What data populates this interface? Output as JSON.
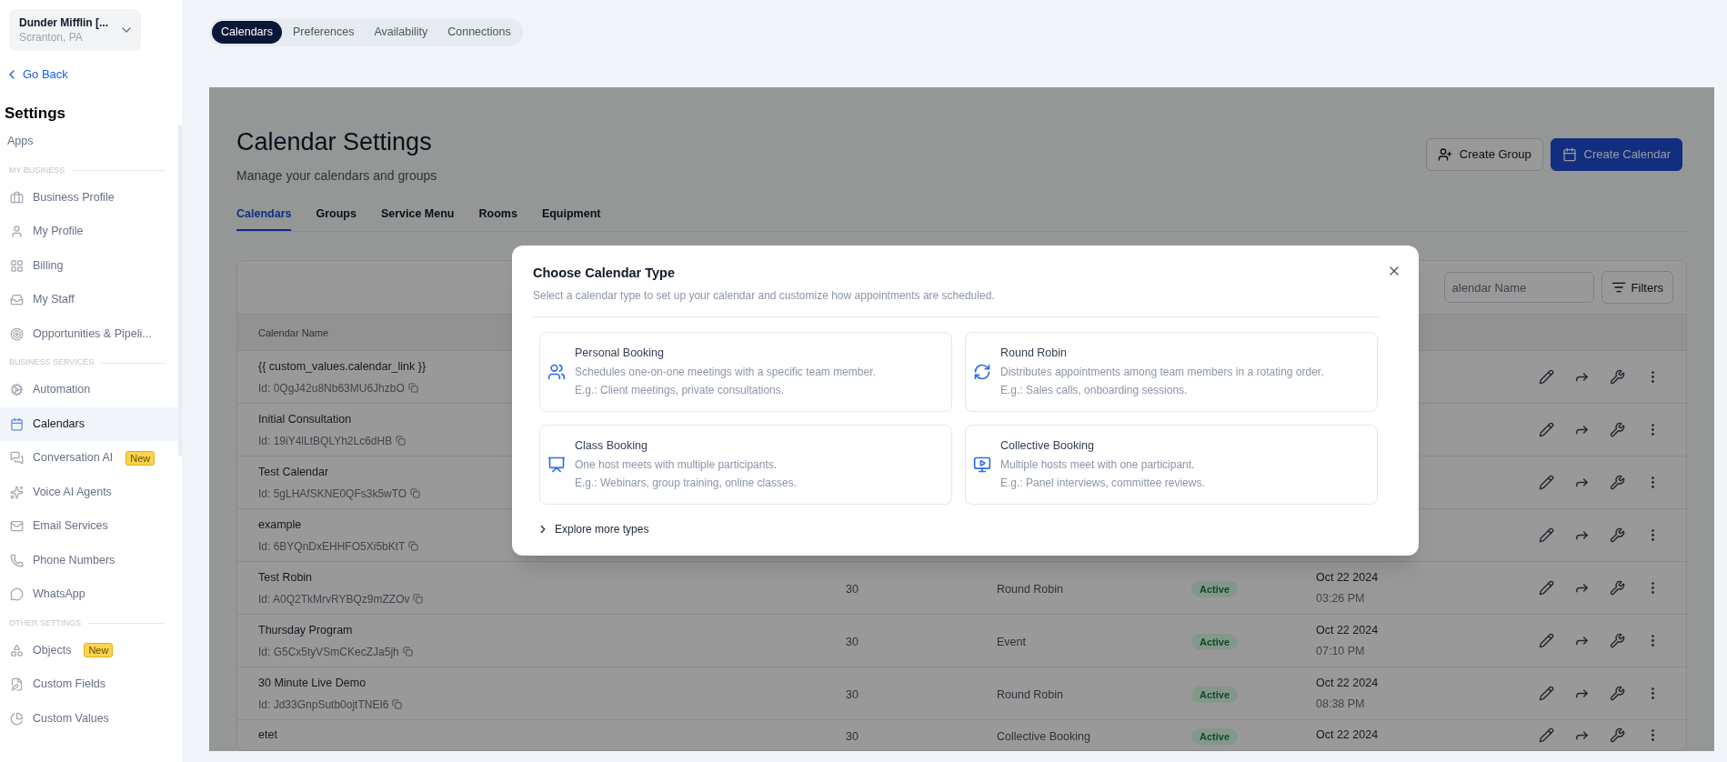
{
  "account": {
    "name": "Dunder Mifflin [...",
    "location": "Scranton, PA"
  },
  "back_link": "Go Back",
  "sidebar": {
    "title": "Settings",
    "sections": [
      {
        "items": [
          {
            "label": "Apps",
            "selected": false
          }
        ]
      },
      {
        "heading": "MY BUSINESS",
        "items": [
          {
            "label": "Business Profile",
            "selected": false
          },
          {
            "label": "My Profile",
            "selected": false
          },
          {
            "label": "Billing",
            "selected": false
          },
          {
            "label": "My Staff",
            "selected": false
          },
          {
            "label": "Opportunities & Pipeli...",
            "selected": false
          }
        ]
      },
      {
        "heading": "BUSINESS SERVICES",
        "items": [
          {
            "label": "Automation",
            "selected": false
          },
          {
            "label": "Calendars",
            "selected": true
          },
          {
            "label": "Conversation AI",
            "selected": false,
            "badge": "New"
          },
          {
            "label": "Voice AI Agents",
            "selected": false
          },
          {
            "label": "Email Services",
            "selected": false
          },
          {
            "label": "Phone Numbers",
            "selected": false
          },
          {
            "label": "WhatsApp",
            "selected": false
          }
        ]
      },
      {
        "heading": "OTHER SETTINGS",
        "items": [
          {
            "label": "Objects",
            "selected": false,
            "badge": "New"
          },
          {
            "label": "Custom Fields",
            "selected": false
          },
          {
            "label": "Custom Values",
            "selected": false
          }
        ]
      }
    ]
  },
  "top_tabs": [
    {
      "label": "Calendars",
      "selected": true
    },
    {
      "label": "Preferences",
      "selected": false
    },
    {
      "label": "Availability",
      "selected": false
    },
    {
      "label": "Connections",
      "selected": false
    }
  ],
  "page": {
    "title": "Calendar Settings",
    "subtitle": "Manage your calendars and groups",
    "buttons": [
      {
        "label": "Create Group",
        "kind": "secondary"
      },
      {
        "label": "Create Calendar",
        "kind": "primary"
      }
    ]
  },
  "tabs": [
    {
      "label": "Calendars",
      "selected": true
    },
    {
      "label": "Groups",
      "selected": false
    },
    {
      "label": "Service Menu",
      "selected": false
    },
    {
      "label": "Rooms",
      "selected": false
    },
    {
      "label": "Equipment",
      "selected": false
    }
  ],
  "search": {
    "placeholder": "alendar Name"
  },
  "filters_button": "Filters",
  "table": {
    "columns": [
      "Calendar Name"
    ],
    "rows": [
      {
        "name": "{{ custom_values.calendar_link }}",
        "id": "Id: 0QgJ42u8Nb63MU6JhzbO"
      },
      {
        "name": "Initial Consultation",
        "id": "Id: 19iY4lLtBQLYh2Lc6dHB"
      },
      {
        "name": "Test Calendar",
        "id": "Id: 5gLHAfSKNE0QFs3k5wTO"
      },
      {
        "name": "example",
        "id": "Id: 6BYQnDxEHHFO5Xi5bKtT"
      },
      {
        "name": "Test Robin",
        "id": "Id: A0Q2TkMrvRYBQz9mZZOv",
        "duration": "30",
        "type": "Round Robin",
        "status": "Active",
        "date": "Oct 22 2024",
        "time": "03:26 PM"
      },
      {
        "name": "Thursday Program",
        "id": "Id: G5Cx5tyVSmCKecZJa5jh",
        "duration": "30",
        "type": "Event",
        "status": "Active",
        "date": "Oct 22 2024",
        "time": "07:10 PM"
      },
      {
        "name": "30 Minute Live Demo",
        "id": "Id: Jd33GnpSutb0ojtTNEI6",
        "duration": "30",
        "type": "Round Robin",
        "status": "Active",
        "date": "Oct 22 2024",
        "time": "08:38 PM"
      },
      {
        "name": "etet",
        "duration": "30",
        "type": "Collective Booking",
        "status": "Active",
        "date": "Oct 22 2024"
      }
    ]
  },
  "modal": {
    "title": "Choose Calendar Type",
    "subtitle": "Select a calendar type to set up your calendar and customize how appointments are scheduled.",
    "options": [
      {
        "title": "Personal Booking",
        "description": "Schedules one-on-one meetings with a specific team member.",
        "example": "E.g.: Client meetings, private consultations."
      },
      {
        "title": "Round Robin",
        "description": "Distributes appointments among team members in a rotating order.",
        "example": "E.g.: Sales calls, onboarding sessions."
      },
      {
        "title": "Class Booking",
        "description": "One host meets with multiple participants.",
        "example": "E.g.: Webinars, group training, online classes."
      },
      {
        "title": "Collective Booking",
        "description": "Multiple hosts meet with one participant.",
        "example": "E.g.: Panel interviews, committee reviews."
      }
    ],
    "more": "Explore more types"
  }
}
